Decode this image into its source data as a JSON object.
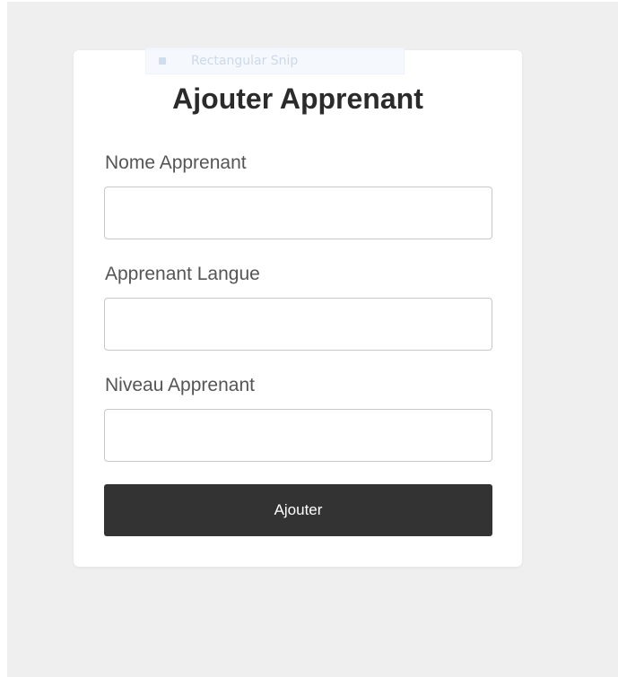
{
  "overlay": {
    "label": "Rectangular Snip",
    "icon": "snip-icon"
  },
  "form": {
    "title": "Ajouter Apprenant",
    "fields": [
      {
        "label": "Nome Apprenant",
        "value": "",
        "placeholder": ""
      },
      {
        "label": "Apprenant Langue",
        "value": "",
        "placeholder": ""
      },
      {
        "label": "Niveau Apprenant",
        "value": "",
        "placeholder": ""
      }
    ],
    "submit_label": "Ajouter"
  },
  "colors": {
    "page_background": "#efefef",
    "card_background": "#ffffff",
    "button_background": "#333333",
    "button_text": "#ffffff",
    "title_text": "#2b2b2b",
    "label_text": "#555555"
  }
}
